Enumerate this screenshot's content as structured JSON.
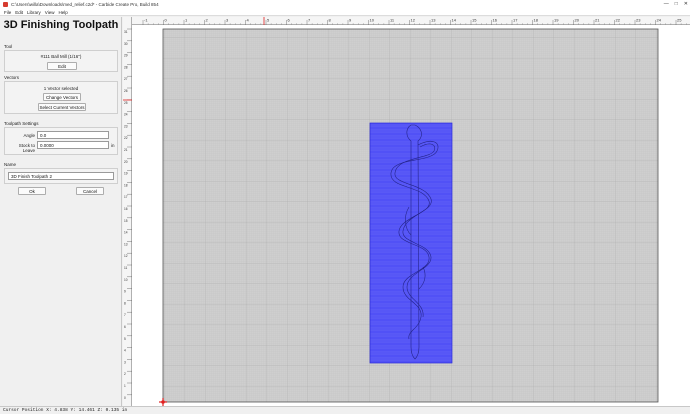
{
  "window": {
    "title": "C:\\Users\\willa\\Downloads\\med_relief.c2d* - Carbide Create Pro, Build 854"
  },
  "menu": {
    "items": [
      "File",
      "Edit",
      "Library",
      "View",
      "Help"
    ]
  },
  "panel": {
    "title": "3D Finishing Toolpath",
    "tool": {
      "section_label": "Tool",
      "tool_name": "#111 Ball Mill (1/16\")",
      "edit_label": "Edit"
    },
    "vectors": {
      "section_label": "Vectors",
      "selected_text": "1 Vector selected",
      "change_label": "Change Vectors",
      "select_current_label": "Select Current Vectors"
    },
    "settings": {
      "section_label": "Toolpath Settings",
      "angle_label": "Angle",
      "angle_value": "0.0",
      "stock_label": "Stock to Leave",
      "stock_value": "0.0000",
      "stock_unit": "in"
    },
    "name": {
      "section_label": "Name",
      "value": "3D Finish Toolpath 2"
    },
    "ok_label": "Ok",
    "cancel_label": "Cancel"
  },
  "rulers": {
    "top_ticks": [
      "-1",
      "0",
      "1",
      "2",
      "3",
      "4",
      "5",
      "6",
      "7",
      "8",
      "9",
      "10",
      "11",
      "12",
      "13",
      "14",
      "15",
      "16",
      "17",
      "18",
      "19",
      "20",
      "21",
      "22",
      "23",
      "24",
      "25"
    ],
    "left_ticks": [
      "31",
      "30",
      "29",
      "28",
      "27",
      "26",
      "25",
      "24",
      "23",
      "22",
      "21",
      "20",
      "19",
      "18",
      "17",
      "16",
      "15",
      "14",
      "13",
      "12",
      "11",
      "10",
      "9",
      "8",
      "7",
      "6",
      "5",
      "4",
      "3",
      "2",
      "1",
      "0"
    ]
  },
  "status": {
    "cursor_text": "Cursor Position X: 4.838 Y: 14.461 Z: 0.135 in"
  },
  "colors": {
    "toolpath": "#3b3bf0",
    "origin": "#e02020",
    "grid_bg": "#cfcfcf"
  }
}
